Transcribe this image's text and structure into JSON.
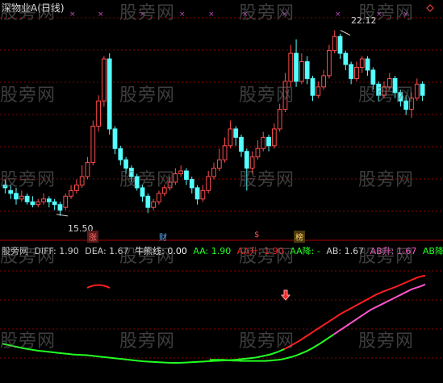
{
  "title": "深物业A(日线)",
  "watermark": "股旁网",
  "colors": {
    "up": "#ff4d4d",
    "down": "#54ffff",
    "green": "#22ff22",
    "red": "#ff1e1e",
    "pink": "#ff55cc",
    "grid": "#8a0000",
    "text": "#d0d0d0",
    "yellow": "#ffff33"
  },
  "price_labels": {
    "high": "22.12",
    "low": "15.50"
  },
  "event_markers": [
    "涨",
    "财",
    "$",
    "榜"
  ],
  "indicator_items": [
    {
      "label": "股旁网",
      "color": "#d0d0d0"
    },
    {
      "label": "DIFF: 1.90",
      "color": "#d0d0d0"
    },
    {
      "label": "DEA: 1.67",
      "color": "#d0d0d0"
    },
    {
      "label": "牛熊线: 0.00",
      "color": "#ffffff"
    },
    {
      "label": "AA: 1.90",
      "color": "#22ff22"
    },
    {
      "label": "AA升: 1.90",
      "color": "#ff2222"
    },
    {
      "label": "AA降: -",
      "color": "#22ff22"
    },
    {
      "label": "AB: 1.67",
      "color": "#d0d0d0"
    },
    {
      "label": "AB升: 1.67",
      "color": "#ff55cc"
    },
    {
      "label": "AB降: -",
      "color": "#22ff22"
    }
  ],
  "chart_data": {
    "type": "candlestick",
    "candles": [
      {
        "o": 16.6,
        "c": 16.5,
        "h": 16.8,
        "l": 16.3
      },
      {
        "o": 16.4,
        "c": 16.3,
        "h": 16.6,
        "l": 16.1
      },
      {
        "o": 16.3,
        "c": 16.1,
        "h": 16.5,
        "l": 15.9
      },
      {
        "o": 16.1,
        "c": 16.2,
        "h": 16.4,
        "l": 16.0
      },
      {
        "o": 16.2,
        "c": 16.0,
        "h": 16.3,
        "l": 15.9
      },
      {
        "o": 16.0,
        "c": 15.9,
        "h": 16.2,
        "l": 15.8
      },
      {
        "o": 15.9,
        "c": 16.0,
        "h": 16.1,
        "l": 15.8
      },
      {
        "o": 16.0,
        "c": 16.1,
        "h": 16.3,
        "l": 15.9
      },
      {
        "o": 16.1,
        "c": 16.0,
        "h": 16.2,
        "l": 15.8
      },
      {
        "o": 16.0,
        "c": 15.9,
        "h": 16.1,
        "l": 15.7
      },
      {
        "o": 15.9,
        "c": 15.7,
        "h": 16.0,
        "l": 15.5
      },
      {
        "o": 15.8,
        "c": 16.2,
        "h": 16.3,
        "l": 15.7
      },
      {
        "o": 16.2,
        "c": 16.4,
        "h": 16.6,
        "l": 16.1
      },
      {
        "o": 16.4,
        "c": 16.6,
        "h": 16.8,
        "l": 16.3
      },
      {
        "o": 16.6,
        "c": 16.9,
        "h": 17.3,
        "l": 16.5
      },
      {
        "o": 16.9,
        "c": 17.4,
        "h": 17.6,
        "l": 16.8
      },
      {
        "o": 17.4,
        "c": 18.7,
        "h": 18.9,
        "l": 17.3
      },
      {
        "o": 18.7,
        "c": 19.6,
        "h": 19.8,
        "l": 18.5
      },
      {
        "o": 19.6,
        "c": 21.1,
        "h": 21.2,
        "l": 19.4
      },
      {
        "o": 21.1,
        "c": 18.6,
        "h": 21.3,
        "l": 18.4
      },
      {
        "o": 18.6,
        "c": 17.9,
        "h": 18.7,
        "l": 17.7
      },
      {
        "o": 17.9,
        "c": 17.5,
        "h": 18.0,
        "l": 17.3
      },
      {
        "o": 17.5,
        "c": 17.2,
        "h": 17.6,
        "l": 17.0
      },
      {
        "o": 17.2,
        "c": 16.9,
        "h": 17.3,
        "l": 16.7
      },
      {
        "o": 16.9,
        "c": 16.5,
        "h": 17.0,
        "l": 16.4
      },
      {
        "o": 16.5,
        "c": 16.2,
        "h": 16.6,
        "l": 16.0
      },
      {
        "o": 16.2,
        "c": 15.8,
        "h": 16.3,
        "l": 15.6
      },
      {
        "o": 15.8,
        "c": 16.0,
        "h": 16.1,
        "l": 15.7
      },
      {
        "o": 16.0,
        "c": 16.3,
        "h": 16.4,
        "l": 15.9
      },
      {
        "o": 16.3,
        "c": 16.5,
        "h": 16.6,
        "l": 16.2
      },
      {
        "o": 16.5,
        "c": 16.7,
        "h": 16.9,
        "l": 16.4
      },
      {
        "o": 16.7,
        "c": 17.0,
        "h": 17.2,
        "l": 16.6
      },
      {
        "o": 17.0,
        "c": 17.1,
        "h": 17.3,
        "l": 16.9
      },
      {
        "o": 17.1,
        "c": 16.8,
        "h": 17.2,
        "l": 16.6
      },
      {
        "o": 16.8,
        "c": 16.5,
        "h": 16.9,
        "l": 16.3
      },
      {
        "o": 16.5,
        "c": 16.1,
        "h": 16.6,
        "l": 15.9
      },
      {
        "o": 16.1,
        "c": 16.4,
        "h": 16.6,
        "l": 16.0
      },
      {
        "o": 16.4,
        "c": 16.9,
        "h": 17.1,
        "l": 16.3
      },
      {
        "o": 16.9,
        "c": 17.2,
        "h": 17.4,
        "l": 16.8
      },
      {
        "o": 17.2,
        "c": 17.5,
        "h": 17.9,
        "l": 17.1
      },
      {
        "o": 17.5,
        "c": 18.0,
        "h": 18.3,
        "l": 17.4
      },
      {
        "o": 18.0,
        "c": 18.6,
        "h": 18.9,
        "l": 17.9
      },
      {
        "o": 18.6,
        "c": 18.3,
        "h": 18.7,
        "l": 18.0
      },
      {
        "o": 18.3,
        "c": 17.8,
        "h": 18.4,
        "l": 17.6
      },
      {
        "o": 17.8,
        "c": 17.2,
        "h": 17.9,
        "l": 16.4
      },
      {
        "o": 17.2,
        "c": 17.6,
        "h": 17.8,
        "l": 17.0
      },
      {
        "o": 17.6,
        "c": 17.9,
        "h": 18.2,
        "l": 17.5
      },
      {
        "o": 17.9,
        "c": 18.3,
        "h": 18.5,
        "l": 17.8
      },
      {
        "o": 18.3,
        "c": 18.0,
        "h": 18.4,
        "l": 17.8
      },
      {
        "o": 18.0,
        "c": 18.6,
        "h": 18.8,
        "l": 17.9
      },
      {
        "o": 18.6,
        "c": 19.3,
        "h": 19.5,
        "l": 18.5
      },
      {
        "o": 19.3,
        "c": 20.3,
        "h": 20.6,
        "l": 19.2
      },
      {
        "o": 20.3,
        "c": 21.3,
        "h": 21.6,
        "l": 20.1
      },
      {
        "o": 21.3,
        "c": 20.3,
        "h": 21.8,
        "l": 20.1
      },
      {
        "o": 20.3,
        "c": 21.0,
        "h": 21.3,
        "l": 20.2
      },
      {
        "o": 21.0,
        "c": 20.4,
        "h": 21.2,
        "l": 20.2
      },
      {
        "o": 20.4,
        "c": 19.8,
        "h": 20.5,
        "l": 19.6
      },
      {
        "o": 19.8,
        "c": 20.1,
        "h": 20.3,
        "l": 19.7
      },
      {
        "o": 20.1,
        "c": 20.5,
        "h": 20.7,
        "l": 20.0
      },
      {
        "o": 20.5,
        "c": 21.4,
        "h": 21.6,
        "l": 20.4
      },
      {
        "o": 21.4,
        "c": 21.9,
        "h": 22.12,
        "l": 21.3
      },
      {
        "o": 21.9,
        "c": 21.3,
        "h": 22.0,
        "l": 21.1
      },
      {
        "o": 21.3,
        "c": 20.9,
        "h": 21.4,
        "l": 20.7
      },
      {
        "o": 20.9,
        "c": 20.4,
        "h": 21.0,
        "l": 20.2
      },
      {
        "o": 20.4,
        "c": 20.8,
        "h": 21.0,
        "l": 20.3
      },
      {
        "o": 20.8,
        "c": 21.1,
        "h": 21.2,
        "l": 20.6
      },
      {
        "o": 21.1,
        "c": 20.7,
        "h": 21.2,
        "l": 20.5
      },
      {
        "o": 20.7,
        "c": 20.2,
        "h": 20.8,
        "l": 20.0
      },
      {
        "o": 20.2,
        "c": 19.8,
        "h": 20.3,
        "l": 19.6
      },
      {
        "o": 19.8,
        "c": 20.1,
        "h": 20.3,
        "l": 19.7
      },
      {
        "o": 20.1,
        "c": 20.4,
        "h": 20.6,
        "l": 20.0
      },
      {
        "o": 20.4,
        "c": 19.9,
        "h": 20.5,
        "l": 19.7
      },
      {
        "o": 19.9,
        "c": 19.6,
        "h": 20.0,
        "l": 19.4
      },
      {
        "o": 19.6,
        "c": 19.3,
        "h": 19.8,
        "l": 19.1
      },
      {
        "o": 19.3,
        "c": 19.7,
        "h": 19.9,
        "l": 19.0
      },
      {
        "o": 19.7,
        "c": 20.2,
        "h": 20.4,
        "l": 19.6
      },
      {
        "o": 20.2,
        "c": 19.8,
        "h": 20.3,
        "l": 19.6
      }
    ],
    "ylim": [
      15.0,
      22.8
    ],
    "series": [
      {
        "name": "DIFF",
        "color": "#22ff22",
        "values": [
          0.12,
          0.08,
          0.04,
          0.0,
          -0.03,
          -0.06,
          -0.08,
          -0.1,
          -0.12,
          -0.14,
          -0.16,
          -0.17,
          -0.18,
          -0.2,
          -0.22,
          -0.24,
          -0.26,
          -0.28,
          -0.3,
          -0.32,
          -0.34,
          -0.35,
          -0.36,
          -0.37,
          -0.38,
          -0.38,
          -0.37,
          -0.36,
          -0.35,
          -0.34,
          -0.33,
          -0.32,
          -0.31,
          -0.3,
          -0.28,
          -0.26,
          -0.24,
          -0.2,
          -0.16,
          -0.1,
          -0.02,
          0.08,
          0.18,
          0.3,
          0.42,
          0.54,
          0.66,
          0.78,
          0.9,
          1.0,
          1.1,
          1.2,
          1.3,
          1.4,
          1.48,
          1.55,
          1.62,
          1.7,
          1.78,
          1.86,
          1.9
        ]
      },
      {
        "name": "DEA",
        "color": "#ff55cc",
        "values": [
          -0.3,
          -0.3,
          -0.3,
          -0.3,
          -0.31,
          -0.32,
          -0.32,
          -0.33,
          -0.33,
          -0.33,
          -0.33,
          -0.33,
          -0.33,
          -0.32,
          -0.31,
          -0.3,
          -0.28,
          -0.25,
          -0.22,
          -0.18,
          -0.13,
          -0.08,
          -0.02,
          0.05,
          0.12,
          0.2,
          0.28,
          0.36,
          0.44,
          0.52,
          0.6,
          0.68,
          0.76,
          0.84,
          0.92,
          1.0,
          1.06,
          1.12,
          1.18,
          1.24,
          1.3,
          1.36,
          1.42,
          1.48,
          1.54,
          1.58,
          1.62,
          1.67
        ]
      }
    ],
    "ind_ylim": [
      -0.8,
      2.4
    ]
  }
}
